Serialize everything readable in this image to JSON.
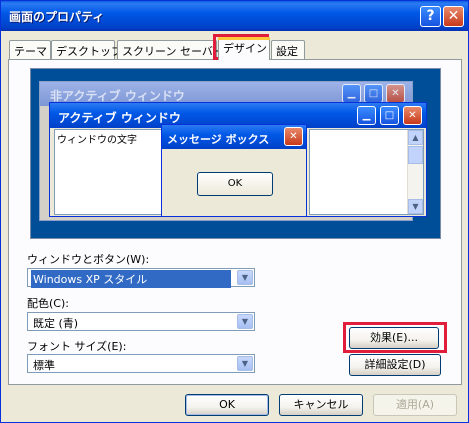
{
  "window": {
    "title": "画面のプロパティ",
    "help_label": "?",
    "close_label": "✕"
  },
  "tabs": [
    {
      "label": "テーマ"
    },
    {
      "label": "デスクトップ"
    },
    {
      "label": "スクリーン セーバー"
    },
    {
      "label": "デザイン",
      "selected": true
    },
    {
      "label": "設定"
    }
  ],
  "preview": {
    "inactive_title": "非アクティブ ウィンドウ",
    "active_title": "アクティブ ウィンドウ",
    "window_text": "ウィンドウの文字",
    "message_title": "メッセージ ボックス",
    "message_ok": "OK",
    "min_glyph": "▁",
    "max_glyph": "□",
    "close_glyph": "✕"
  },
  "fields": {
    "style_label": "ウィンドウとボタン(W):",
    "style_value": "Windows XP スタイル",
    "color_label": "配色(C):",
    "color_value": "既定 (青)",
    "font_label": "フォント サイズ(E):",
    "font_value": "標準"
  },
  "buttons": {
    "effects": "効果(E)...",
    "advanced": "詳細設定(D)",
    "ok": "OK",
    "cancel": "キャンセル",
    "apply": "適用(A)"
  },
  "icons": {
    "dropdown_arrow": "▼",
    "scroll_up": "▲",
    "scroll_down": "▼"
  },
  "colors": {
    "titlebar": "#0058e6",
    "face": "#ece9d8",
    "desktop": "#004e98",
    "highlight_annotation": "#e01e3c",
    "selection": "#316ac5"
  }
}
